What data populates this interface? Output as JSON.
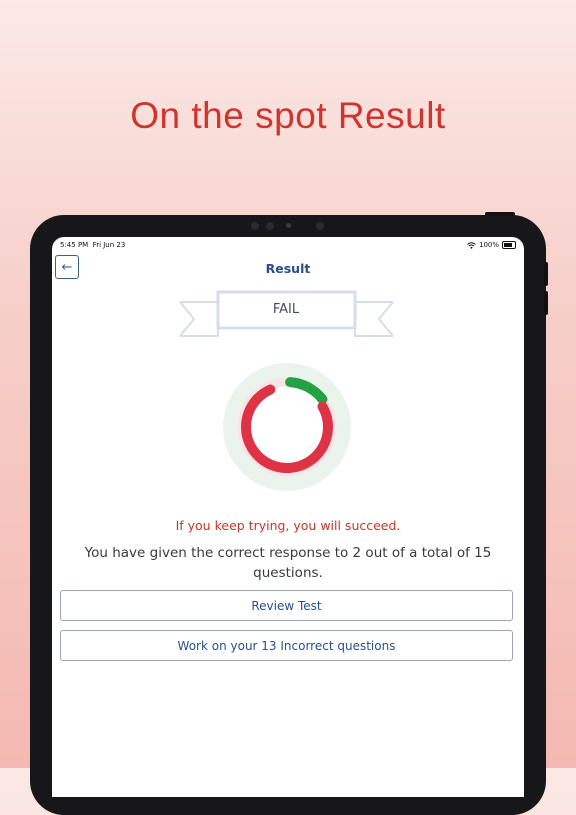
{
  "headline": "On the spot Result",
  "colors": {
    "headline": "#d1342c",
    "brand_blue": "#274e8a",
    "fail_red": "#de3344",
    "pass_green": "#24a045",
    "message_red": "#c9352c"
  },
  "status_bar": {
    "time": "5:45 PM",
    "date": "Fri Jun 23",
    "battery": "100%"
  },
  "header": {
    "back_icon": "arrow-left-icon",
    "title": "Result"
  },
  "result": {
    "badge": "FAIL",
    "correct": 2,
    "incorrect": 13,
    "total": 15
  },
  "messages": {
    "encouragement": "If you keep trying, you will succeed.",
    "summary": "You have given the correct response to 2 out of a total of 15 questions."
  },
  "buttons": {
    "review": "Review Test",
    "work_incorrect": "Work on your 13 Incorrect questions"
  }
}
